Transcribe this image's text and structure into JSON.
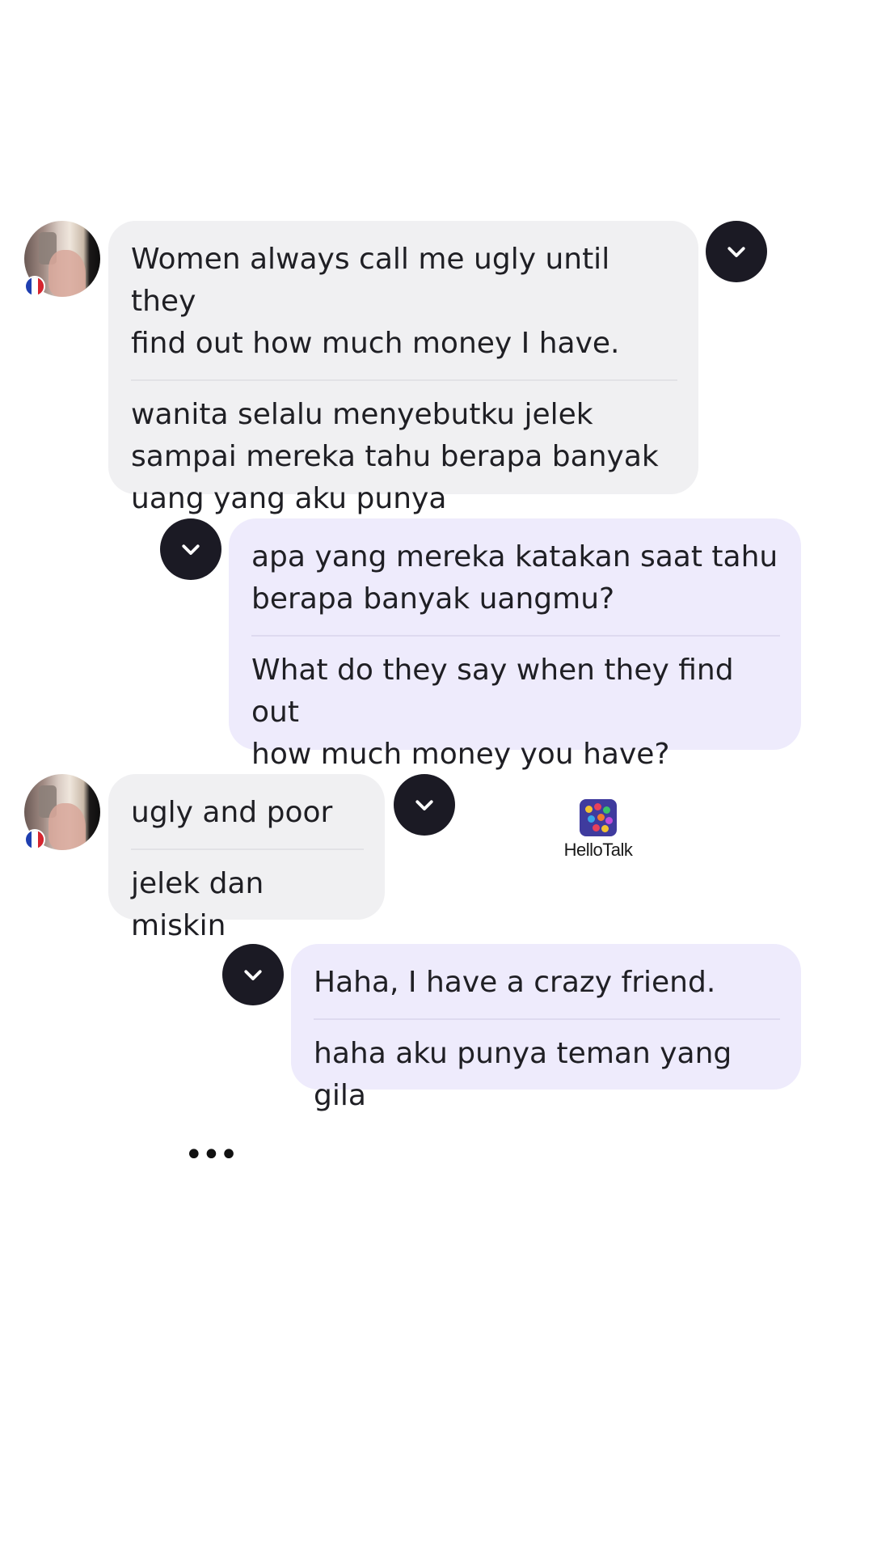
{
  "messages": [
    {
      "side": "incoming",
      "original": "Women always call me ugly until they\nfind out how much money I have.",
      "translation": "wanita selalu menyebutku jelek\nsampai mereka tahu berapa banyak\nuang yang aku punya"
    },
    {
      "side": "outgoing",
      "original": "apa yang mereka katakan saat tahu\nberapa banyak uangmu?",
      "translation": "What do they say when they find out\nhow much money you have?"
    },
    {
      "side": "incoming",
      "original": "ugly and poor",
      "translation": "jelek dan miskin"
    },
    {
      "side": "outgoing",
      "original": "Haha, I have a crazy friend.",
      "translation": "haha aku punya teman yang gila"
    }
  ],
  "watermark": {
    "text": "HelloTalk",
    "icon": "hellotalk-logo-icon"
  },
  "typing_indicator": "•••",
  "icons": {
    "message_menu": "chevron-down-icon",
    "sender_flag": "france-flag-icon"
  },
  "colors": {
    "incoming_bubble": "#f0f0f2",
    "outgoing_bubble": "#eeebfc",
    "chevron_button": "#1b1a24"
  }
}
